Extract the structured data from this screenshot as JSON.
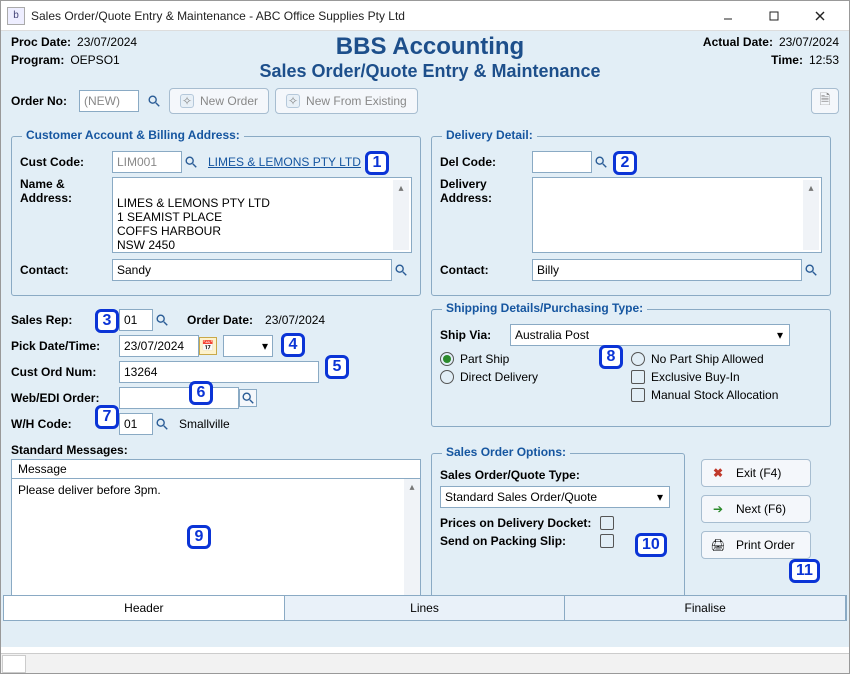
{
  "window": {
    "title": "Sales Order/Quote Entry & Maintenance - ABC Office Supplies Pty Ltd"
  },
  "header": {
    "proc_date_label": "Proc Date:",
    "proc_date": "23/07/2024",
    "program_label": "Program:",
    "program": "OEPSO1",
    "actual_date_label": "Actual Date:",
    "actual_date": "23/07/2024",
    "time_label": "Time:",
    "time": "12:53",
    "app_title": "BBS Accounting",
    "app_subtitle": "Sales Order/Quote Entry & Maintenance"
  },
  "order": {
    "order_no_label": "Order No:",
    "order_no_value": "(NEW)",
    "new_order_label": "New Order",
    "new_from_existing_label": "New From Existing"
  },
  "customer": {
    "group_title": "Customer Account & Billing Address:",
    "cust_code_label": "Cust Code:",
    "cust_code_value": "LIM001",
    "cust_link_text": "LIMES & LEMONS PTY LTD",
    "name_addr_label": "Name &\nAddress:",
    "name_address_text": "LIMES & LEMONS PTY LTD\n1 SEAMIST PLACE\nCOFFS HARBOUR\nNSW 2450",
    "contact_label": "Contact:",
    "contact_value": "Sandy"
  },
  "delivery": {
    "group_title": "Delivery Detail:",
    "del_code_label": "Del Code:",
    "del_code_value": "",
    "delivery_addr_label": "Delivery\nAddress:",
    "delivery_addr_text": "",
    "contact_label": "Contact:",
    "contact_value": "Billy"
  },
  "sales": {
    "sales_rep_label": "Sales Rep:",
    "sales_rep_value": "01",
    "order_date_label": "Order Date:",
    "order_date_value": "23/07/2024",
    "pick_date_label": "Pick Date/Time:",
    "pick_date_value": "23/07/2024",
    "pick_time_value": "",
    "cust_ord_label": "Cust Ord Num:",
    "cust_ord_value": "13264",
    "web_edi_label": "Web/EDI Order:",
    "web_edi_value": "",
    "wh_code_label": "W/H Code:",
    "wh_code_value": "01",
    "wh_code_name": "Smallville"
  },
  "shipping": {
    "group_title": "Shipping Details/Purchasing Type:",
    "ship_via_label": "Ship Via:",
    "ship_via_value": "Australia Post",
    "part_ship_label": "Part Ship",
    "direct_delivery_label": "Direct Delivery",
    "no_part_ship_label": "No Part Ship Allowed",
    "exclusive_buyin_label": "Exclusive Buy-In",
    "manual_stock_label": "Manual Stock Allocation"
  },
  "messages": {
    "header_label": "Standard Messages:",
    "col_header": "Message",
    "body": "Please deliver before 3pm."
  },
  "options": {
    "group_title": "Sales Order Options:",
    "type_label": "Sales Order/Quote Type:",
    "type_value": "Standard Sales Order/Quote",
    "prices_docket_label": "Prices on Delivery Docket:",
    "packing_slip_label": "Send on Packing Slip:"
  },
  "actions": {
    "exit_label": "Exit (F4)",
    "next_label": "Next (F6)",
    "print_label": "Print Order"
  },
  "tabs": {
    "header": "Header",
    "lines": "Lines",
    "finalise": "Finalise"
  },
  "markers": {
    "1": "1",
    "2": "2",
    "3": "3",
    "4": "4",
    "5": "5",
    "6": "6",
    "7": "7",
    "8": "8",
    "9": "9",
    "10": "10",
    "11": "11"
  },
  "colors": {
    "accent": "#1656a0",
    "marker": "#0b34d6"
  }
}
